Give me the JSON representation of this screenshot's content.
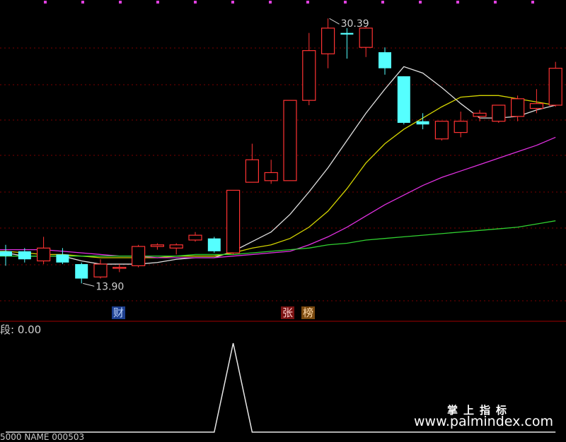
{
  "chart_data": {
    "type": "candlestick",
    "main_panel": {
      "price_range": [
        12.2,
        31.2
      ],
      "annotations": {
        "high": "30.39",
        "low": "13.90"
      },
      "badges": [
        "财",
        "张",
        "榜"
      ],
      "candles": [
        {
          "o": 15.9,
          "h": 16.3,
          "l": 15.0,
          "c": 15.6
        },
        {
          "o": 15.9,
          "h": 16.1,
          "l": 15.2,
          "c": 15.4
        },
        {
          "o": 15.3,
          "h": 16.8,
          "l": 15.1,
          "c": 16.1
        },
        {
          "o": 15.7,
          "h": 16.1,
          "l": 15.1,
          "c": 15.2
        },
        {
          "o": 15.1,
          "h": 15.2,
          "l": 13.9,
          "c": 14.2
        },
        {
          "o": 14.3,
          "h": 15.4,
          "l": 14.2,
          "c": 15.1
        },
        {
          "o": 14.9,
          "h": 15.1,
          "l": 14.6,
          "c": 14.9
        },
        {
          "o": 15.0,
          "h": 16.3,
          "l": 14.9,
          "c": 16.2
        },
        {
          "o": 16.2,
          "h": 16.4,
          "l": 16.0,
          "c": 16.3
        },
        {
          "o": 16.1,
          "h": 16.4,
          "l": 15.7,
          "c": 16.3
        },
        {
          "o": 16.6,
          "h": 17.1,
          "l": 16.5,
          "c": 16.9
        },
        {
          "o": 16.7,
          "h": 16.8,
          "l": 15.8,
          "c": 15.9
        },
        {
          "o": 15.8,
          "h": 19.7,
          "l": 15.7,
          "c": 19.7
        },
        {
          "o": 20.2,
          "h": 22.6,
          "l": 20.2,
          "c": 21.6
        },
        {
          "o": 20.3,
          "h": 21.6,
          "l": 20.1,
          "c": 20.8
        },
        {
          "o": 20.3,
          "h": 25.3,
          "l": 20.3,
          "c": 25.3
        },
        {
          "o": 25.3,
          "h": 29.5,
          "l": 25.0,
          "c": 28.4
        },
        {
          "o": 28.2,
          "h": 30.4,
          "l": 27.3,
          "c": 29.8
        },
        {
          "o": 29.5,
          "h": 29.8,
          "l": 27.9,
          "c": 29.4
        },
        {
          "o": 28.6,
          "h": 29.9,
          "l": 28.0,
          "c": 29.8
        },
        {
          "o": 28.3,
          "h": 28.6,
          "l": 26.9,
          "c": 27.3
        },
        {
          "o": 26.8,
          "h": 26.8,
          "l": 23.8,
          "c": 23.9
        },
        {
          "o": 24.0,
          "h": 24.5,
          "l": 23.5,
          "c": 23.8
        },
        {
          "o": 22.9,
          "h": 24.0,
          "l": 22.8,
          "c": 24.0
        },
        {
          "o": 23.3,
          "h": 24.6,
          "l": 23.0,
          "c": 24.0
        },
        {
          "o": 24.3,
          "h": 24.7,
          "l": 24.0,
          "c": 24.5
        },
        {
          "o": 24.0,
          "h": 25.0,
          "l": 23.9,
          "c": 25.0
        },
        {
          "o": 24.3,
          "h": 25.6,
          "l": 24.0,
          "c": 25.4
        },
        {
          "o": 24.8,
          "h": 26.0,
          "l": 24.5,
          "c": 25.1
        },
        {
          "o": 25.0,
          "h": 27.7,
          "l": 24.9,
          "c": 27.3
        }
      ],
      "moving_averages": [
        {
          "color": "#e0e0e0",
          "values": [
            15.8,
            15.6,
            15.6,
            15.6,
            15.3,
            15.1,
            15.1,
            15.1,
            15.2,
            15.4,
            15.5,
            15.5,
            15.9,
            16.5,
            17.1,
            18.2,
            19.6,
            21.1,
            22.8,
            24.5,
            26.0,
            27.4,
            27.0,
            26.1,
            25.1,
            24.2,
            24.2,
            24.3,
            24.7,
            25.0
          ]
        },
        {
          "color": "#d4d400",
          "values": [
            15.9,
            15.8,
            15.7,
            15.7,
            15.6,
            15.5,
            15.5,
            15.5,
            15.5,
            15.6,
            15.6,
            15.6,
            15.8,
            16.1,
            16.3,
            16.7,
            17.4,
            18.4,
            19.8,
            21.4,
            22.6,
            23.5,
            24.2,
            24.9,
            25.5,
            25.6,
            25.6,
            25.4,
            25.2,
            25.0
          ]
        },
        {
          "color": "#e030e0",
          "values": [
            16.0,
            16.0,
            16.0,
            15.9,
            15.8,
            15.7,
            15.6,
            15.6,
            15.5,
            15.5,
            15.5,
            15.5,
            15.6,
            15.7,
            15.8,
            15.9,
            16.3,
            16.8,
            17.4,
            18.1,
            18.8,
            19.4,
            20.0,
            20.5,
            20.9,
            21.3,
            21.7,
            22.1,
            22.5,
            23.0
          ]
        },
        {
          "color": "#30d030",
          "values": [
            15.6,
            15.6,
            15.6,
            15.6,
            15.6,
            15.6,
            15.6,
            15.6,
            15.6,
            15.6,
            15.7,
            15.7,
            15.7,
            15.8,
            15.9,
            16.0,
            16.1,
            16.3,
            16.4,
            16.6,
            16.7,
            16.8,
            16.9,
            17.0,
            17.1,
            17.2,
            17.3,
            17.4,
            17.6,
            17.8
          ]
        }
      ]
    },
    "sub_panel": {
      "label": "段: 0.00",
      "values": [
        0,
        0,
        0,
        0,
        0,
        0,
        0,
        0,
        0,
        0,
        0,
        0,
        1,
        0,
        0,
        0,
        0,
        0,
        0,
        0,
        0,
        0,
        0,
        0,
        0,
        0,
        0,
        0,
        0,
        0
      ]
    }
  },
  "watermark": {
    "cn": "掌上指标",
    "url": "www.palmindex.com"
  },
  "bottom_label": "5000 NAME 000503"
}
